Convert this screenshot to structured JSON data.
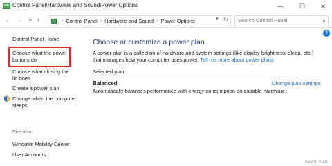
{
  "window": {
    "title": "Control Panel\\Hardware and Sound\\Power Options",
    "minimize": "—",
    "maximize": "☐",
    "close": "✕"
  },
  "nav": {
    "back": "←",
    "forward": "→",
    "recent": "⌄",
    "up": "↑",
    "crumbs": [
      "Control Panel",
      "Hardware and Sound",
      "Power Options"
    ],
    "search_placeholder": "Search Control Panel"
  },
  "sidebar": {
    "home": "Control Panel Home",
    "links": [
      "Choose what the power buttons do",
      "Choose what closing the lid does",
      "Create a power plan",
      "Change when the computer sleeps"
    ],
    "see_also_heading": "See also",
    "see_also": [
      "Windows Mobility Center",
      "User Accounts"
    ]
  },
  "main": {
    "heading": "Choose or customize a power plan",
    "description": "A power plan is a collection of hardware and system settings (like display brightness, sleep, etc.) that manages how your computer uses power. ",
    "description_link": "Tell me more about power plans",
    "selected_label": "Selected plan",
    "plan": {
      "name": "Balanced",
      "settings_link": "Change plan settings",
      "description": "Automatically balances performance with energy consumption on capable hardware."
    },
    "help": "?"
  },
  "watermark": "wsxdn.com",
  "colors": {
    "heading": "#1e3b87",
    "link": "#1a6cc4",
    "highlight": "#e0262b"
  }
}
